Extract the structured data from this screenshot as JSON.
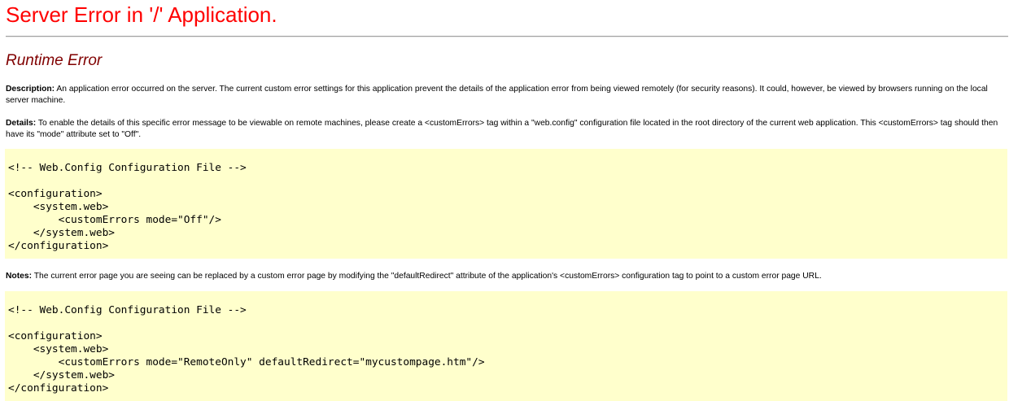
{
  "page": {
    "title": "Server Error in '/' Application.",
    "subtitle": "Runtime Error"
  },
  "description": {
    "label": "Description:",
    "text": " An application error occurred on the server. The current custom error settings for this application prevent the details of the application error from being viewed remotely (for security reasons). It could, however, be viewed by browsers running on the local server machine."
  },
  "details": {
    "label": "Details:",
    "text": " To enable the details of this specific error message to be viewable on remote machines, please create a <customErrors> tag within a \"web.config\" configuration file located in the root directory of the current web application. This <customErrors> tag should then have its \"mode\" attribute set to \"Off\"."
  },
  "code_block_1": {
    "lines": [
      "",
      "<!-- Web.Config Configuration File -->",
      "",
      "<configuration>",
      "    <system.web>",
      "        <customErrors mode=\"Off\"/>",
      "    </system.web>",
      "</configuration>"
    ]
  },
  "notes": {
    "label": "Notes:",
    "text": " The current error page you are seeing can be replaced by a custom error page by modifying the \"defaultRedirect\" attribute of the application's <customErrors> configuration tag to point to a custom error page URL."
  },
  "code_block_2": {
    "lines": [
      "",
      "<!-- Web.Config Configuration File -->",
      "",
      "<configuration>",
      "    <system.web>",
      "        <customErrors mode=\"RemoteOnly\" defaultRedirect=\"mycustompage.htm\"/>",
      "    </system.web>",
      "</configuration>"
    ]
  }
}
